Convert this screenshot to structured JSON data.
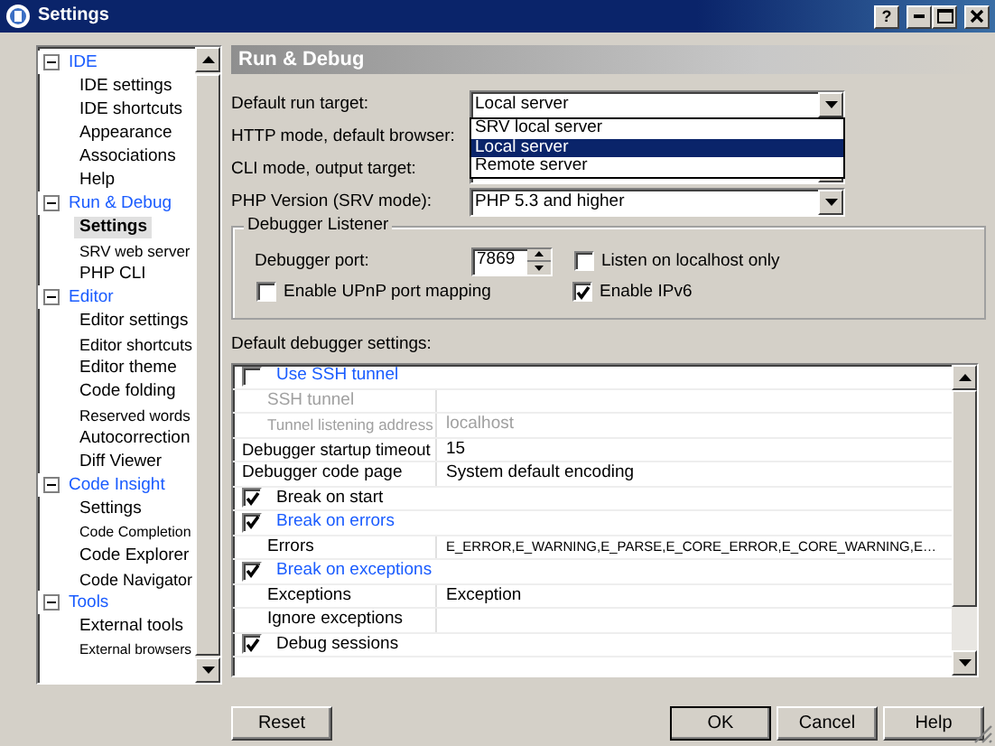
{
  "window": {
    "title": "Settings",
    "help_button": "?"
  },
  "tree": [
    {
      "label": "IDE",
      "expanded": true,
      "children": [
        {
          "label": "IDE settings",
          "selected": false
        },
        {
          "label": "IDE shortcuts",
          "selected": false
        },
        {
          "label": "Appearance",
          "selected": false
        },
        {
          "label": "Associations",
          "selected": false
        },
        {
          "label": "Help",
          "selected": false
        }
      ]
    },
    {
      "label": "Run & Debug",
      "expanded": true,
      "children": [
        {
          "label": "Settings",
          "selected": true
        },
        {
          "label": "SRV web server",
          "selected": false
        },
        {
          "label": "PHP CLI",
          "selected": false
        }
      ]
    },
    {
      "label": "Editor",
      "expanded": true,
      "children": [
        {
          "label": "Editor settings",
          "selected": false
        },
        {
          "label": "Editor shortcuts",
          "selected": false
        },
        {
          "label": "Editor theme",
          "selected": false
        },
        {
          "label": "Code folding",
          "selected": false
        },
        {
          "label": "Reserved words",
          "selected": false
        },
        {
          "label": "Autocorrection",
          "selected": false
        },
        {
          "label": "Diff Viewer",
          "selected": false
        }
      ]
    },
    {
      "label": "Code Insight",
      "expanded": true,
      "children": [
        {
          "label": "Settings",
          "selected": false
        },
        {
          "label": "Code Completion",
          "selected": false
        },
        {
          "label": "Code Explorer",
          "selected": false
        },
        {
          "label": "Code Navigator",
          "selected": false
        }
      ]
    },
    {
      "label": "Tools",
      "expanded": true,
      "children": [
        {
          "label": "External tools",
          "selected": false
        },
        {
          "label": "External browsers",
          "selected": false
        }
      ]
    }
  ],
  "panel": {
    "title": "Run & Debug",
    "fields": [
      {
        "label": "Default run target:",
        "value": "Local server",
        "options": [
          {
            "label": "SRV local server",
            "selected": false
          },
          {
            "label": "Local server",
            "selected": true
          },
          {
            "label": "Remote server",
            "selected": false
          }
        ]
      },
      {
        "label": "HTTP mode, default browser:"
      },
      {
        "label": "CLI mode, output target:"
      },
      {
        "label": "PHP Version (SRV mode):",
        "value": "PHP 5.3 and higher"
      }
    ],
    "listener": {
      "title": "Debugger Listener",
      "port_label": "Debugger port:",
      "port": "7869",
      "localhost_only": {
        "label": "Listen on localhost only",
        "checked": false
      },
      "upnp": {
        "label": "Enable UPnP port mapping",
        "checked": false
      },
      "ipv6": {
        "label": "Enable IPv6",
        "checked": true
      }
    },
    "grid_label": "Default debugger settings:",
    "grid": [
      {
        "kind": "check",
        "label": "Use SSH tunnel",
        "checked": false,
        "link": true
      },
      {
        "kind": "prop",
        "label": "SSH tunnel",
        "disabled": true,
        "indent": true
      },
      {
        "kind": "prop",
        "label": "Tunnel listening address",
        "value": "localhost",
        "disabled": true,
        "indent": true
      },
      {
        "kind": "prop",
        "label": "Debugger startup timeout",
        "value": "15",
        "disabled": false,
        "indent": false
      },
      {
        "kind": "prop",
        "label": "Debugger code page",
        "value": "System default encoding",
        "disabled": false,
        "indent": false
      },
      {
        "kind": "check",
        "label": "Break on start",
        "checked": true,
        "link": false
      },
      {
        "kind": "check",
        "label": "Break on errors",
        "checked": true,
        "link": true
      },
      {
        "kind": "prop",
        "label": "Errors",
        "value": "E_ERROR,E_WARNING,E_PARSE,E_CORE_ERROR,E_CORE_WARNING,E…",
        "disabled": false,
        "indent": true
      },
      {
        "kind": "check",
        "label": "Break on exceptions",
        "checked": true,
        "link": true
      },
      {
        "kind": "prop",
        "label": "Exceptions",
        "value": "Exception",
        "disabled": false,
        "indent": true
      },
      {
        "kind": "prop",
        "label": "Ignore exceptions",
        "disabled": false,
        "indent": true
      },
      {
        "kind": "check",
        "label": "Debug sessions",
        "checked": true,
        "link": false
      }
    ]
  },
  "buttons": {
    "reset": "Reset",
    "ok": "OK",
    "cancel": "Cancel",
    "help": "Help"
  }
}
